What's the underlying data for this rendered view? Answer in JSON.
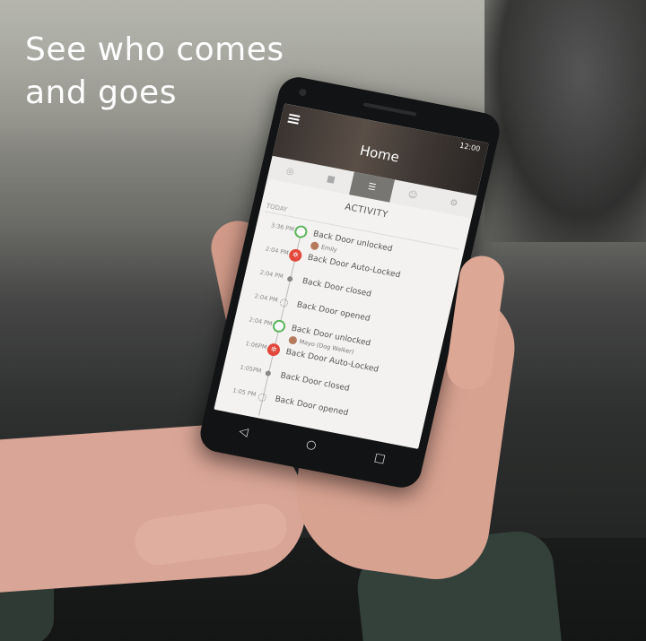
{
  "headline": "See who comes\nand goes",
  "app": {
    "status_time": "12:00",
    "title": "Home",
    "tabs": [
      "◎",
      "■",
      "☰",
      "☺",
      "⚙"
    ],
    "active_tab": 2,
    "section_title": "ACTIVITY",
    "today_label": "TODAY",
    "events": [
      {
        "time": "3:36 PM",
        "label": "Back Door unlocked",
        "user": "Emily",
        "status": "green"
      },
      {
        "time": "2:04 PM",
        "label": "Back Door Auto-Locked",
        "user": "",
        "status": "red"
      },
      {
        "time": "2:04 PM",
        "label": "Back Door closed",
        "user": "",
        "status": "gray"
      },
      {
        "time": "2:04 PM",
        "label": "Back Door opened",
        "user": "",
        "status": "dashed"
      },
      {
        "time": "2:04 PM",
        "label": "Back Door unlocked",
        "user": "Mayo (Dog Walker)",
        "status": "green"
      },
      {
        "time": "1:06PM",
        "label": "Back Door Auto-Locked",
        "user": "",
        "status": "red"
      },
      {
        "time": "1:05PM",
        "label": "Back Door closed",
        "user": "",
        "status": "gray"
      },
      {
        "time": "1:05 PM",
        "label": "Back Door opened",
        "user": "",
        "status": "dashed"
      }
    ]
  },
  "nav": {
    "back": "◁",
    "home": "○",
    "recents": "□"
  },
  "colors": {
    "green": "#5bb55b",
    "red": "#e2483b",
    "header": "#4a423c"
  }
}
